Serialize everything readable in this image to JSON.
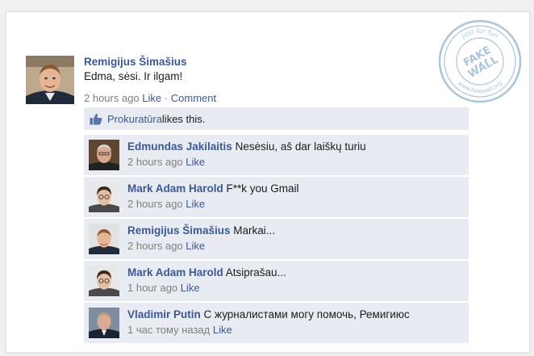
{
  "post": {
    "author": "Remigijus Šimašius",
    "text": "Edma, sėsi. Ir ilgam!",
    "time": "2 hours ago",
    "like_label": "Like",
    "separator": "·",
    "comment_label": "Comment"
  },
  "likes": {
    "liker": "Prokuratūra",
    "text": " likes this."
  },
  "comments": [
    {
      "author": "Edmundas Jakilaitis",
      "text": " Nesėsiu, aš dar laiškų turiu",
      "time": "2 hours ago",
      "like_label": "Like"
    },
    {
      "author": "Mark Adam Harold",
      "text": " F**k you Gmail",
      "time": "2 hours ago",
      "like_label": "Like"
    },
    {
      "author": "Remigijus Šimašius",
      "text": " Markai...",
      "time": "2 hours ago",
      "like_label": "Like"
    },
    {
      "author": "Mark Adam Harold",
      "text": " Atsiprašau...",
      "time": "1 hour ago",
      "like_label": "Like"
    },
    {
      "author": "Vladimir Putin",
      "text": " С журналистами могу помочь, Ремигиюс",
      "time": "1 час тому назад",
      "like_label": "Like"
    }
  ],
  "stamp": {
    "top_text": "just for fun",
    "center_text_1": "FAKE",
    "center_text_2": "WALL",
    "bottom_text": "www.fakewall.org"
  },
  "colors": {
    "link": "#3b5998",
    "comment_bg": "#e9ebf2",
    "meta_text": "#7f7f7f",
    "stamp": "#a9c4dc"
  }
}
